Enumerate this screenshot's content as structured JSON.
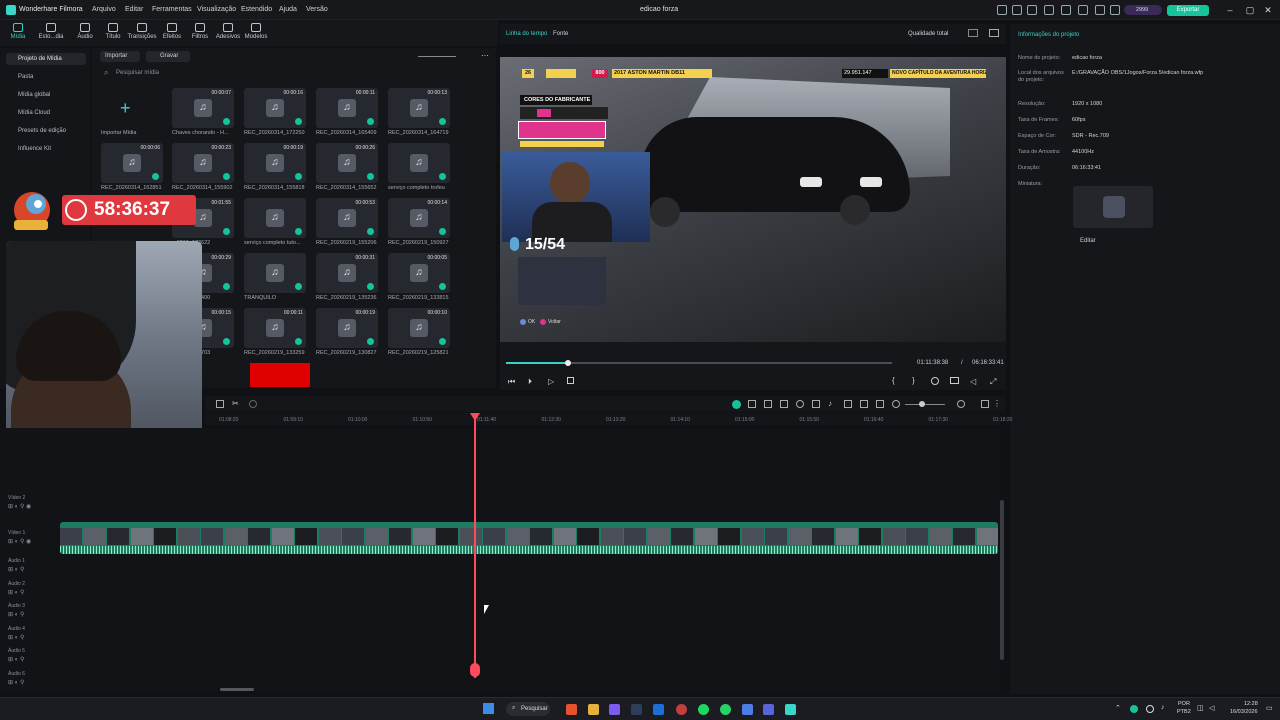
{
  "app": {
    "name": "Wonderhare Filmora",
    "project_title": "edicao forza",
    "menu": [
      "Arquivo",
      "Editar",
      "Ferramentas",
      "Visualização",
      "Estendido",
      "Ajuda",
      "Versão"
    ],
    "credits": "2999",
    "export_label": "Exportar"
  },
  "toolbar": {
    "tools": [
      "Mídia",
      "Esto...dia",
      "Áudio",
      "Título",
      "Transições",
      "Efeitos",
      "Filtros",
      "Adesivos",
      "Modelos"
    ]
  },
  "nav": {
    "items": [
      "Projeto de Mídia",
      "Pasta",
      "Mídia global",
      "Mídia Cloud",
      "Presets de edição",
      "Influence Kit"
    ]
  },
  "media": {
    "import_label": "Importar",
    "record_label": "Gravar",
    "search_placeholder": "Pesquisar mídia",
    "import_media_label": "Importar Mídia",
    "tiles": [
      {
        "name": "Chaves chorando - H...",
        "dur": "00:00:07"
      },
      {
        "name": "REC_20260314_172250",
        "dur": "00:00:16"
      },
      {
        "name": "REC_20260314_165409",
        "dur": "00:00:11"
      },
      {
        "name": "REC_20260314_164719",
        "dur": "00:00:13"
      },
      {
        "name": "REC_20260314_162851",
        "dur": "00:00:06"
      },
      {
        "name": "REC_20260314_155902",
        "dur": "00:00:23"
      },
      {
        "name": "REC_20260314_155818",
        "dur": "00:00:19"
      },
      {
        "name": "REC_20260314_155652",
        "dur": "00:00:26"
      },
      {
        "name": "serviço completo trofeu",
        "dur": ""
      },
      {
        "name": "...0219_173622",
        "dur": "00:01:55"
      },
      {
        "name": "serviço completo tuto...",
        "dur": ""
      },
      {
        "name": "REC_20260219_155206",
        "dur": "00:00:53"
      },
      {
        "name": "REC_20260219_150927",
        "dur": "00:00:14"
      },
      {
        "name": "...0219_143400",
        "dur": "00:00:29"
      },
      {
        "name": "TRANQUILO",
        "dur": ""
      },
      {
        "name": "REC_20260219_135236",
        "dur": "00:00:31"
      },
      {
        "name": "REC_20260219_133815",
        "dur": "00:00:05"
      },
      {
        "name": "...0219_133703",
        "dur": "00:00:15"
      },
      {
        "name": "REC_20260219_133259",
        "dur": "00:00:11"
      },
      {
        "name": "REC_20260219_130827",
        "dur": "00:00:19"
      },
      {
        "name": "REC_20260219_125821",
        "dur": "00:00:10"
      }
    ]
  },
  "overlay": {
    "timer": "58:36:37"
  },
  "preview": {
    "tab_timeline": "Linha do tempo",
    "tab_source": "Fonte",
    "quality": "Qualidade total",
    "current_time": "01:11:38:38",
    "separator": "/",
    "total_time": "06:16:33:41",
    "progress": 0.16,
    "game": {
      "position": "26",
      "car": "2017 ASTON MARTIN DB11",
      "value": "800",
      "badge": "CORES DO FABRICANTE",
      "score": "29.951.147",
      "chapter": "NOVO CAPÍTULO DA AVENTURA HORIZON",
      "trophy_count": "15/54",
      "ok": "OK",
      "back": "Voltar"
    }
  },
  "project_info": {
    "title": "Informações do projeto",
    "fields": [
      {
        "label": "Nome do projeto:",
        "value": "edicao forza"
      },
      {
        "label": "Local dos arquivos do projeto:",
        "value": "E:/GRAVAÇÃO OBS/1Jogos/Forza 5/edicao forza.wfp"
      },
      {
        "label": "Resolução:",
        "value": "1920 x 1080"
      },
      {
        "label": "Taxa de Frames:",
        "value": "60fps"
      },
      {
        "label": "Espaço de Cor:",
        "value": "SDR - Rec.709"
      },
      {
        "label": "Taxa de Amostra:",
        "value": "44100Hz"
      },
      {
        "label": "Duração:",
        "value": "06:16:33:41"
      },
      {
        "label": "Miniatura:",
        "value": ""
      }
    ],
    "edit_label": "Editar"
  },
  "timeline": {
    "ruler": [
      "01:08:20",
      "01:09:10",
      "01:10:00",
      "01:10:50",
      "01:11:40",
      "01:12:30",
      "01:13:20",
      "01:14:10",
      "01:15:00",
      "01:15:50",
      "01:16:40",
      "01:17:30",
      "01:18:20"
    ],
    "tracks": [
      "Vídeo 2",
      "Vídeo 1",
      "Áudio 1",
      "Áudio 2",
      "Áudio 3",
      "Áudio 4",
      "Áudio 5",
      "Áudio 6"
    ]
  },
  "taskbar": {
    "search": "Pesquisar",
    "lang_1": "POR",
    "lang_2": "PTB2",
    "time": "12:28",
    "date": "16/03/2026"
  },
  "colors": {
    "accent": "#16c39a",
    "teal": "#39d3c4",
    "playhead": "#ff4b5c",
    "timer_bg": "#e0383f"
  }
}
